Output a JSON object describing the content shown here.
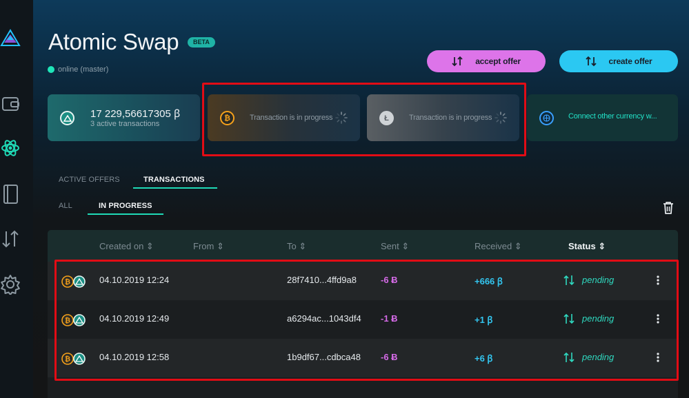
{
  "app": {
    "title": "Atomic Swap",
    "beta_badge": "BETA",
    "status": "online (master)"
  },
  "actions": {
    "accept_offer": "accept offer",
    "create_offer": "create offer"
  },
  "cards": {
    "main_balance": "17 229,56617305 ꞵ",
    "main_sub": "3 active transactions",
    "btc_status": "Transaction is in progress",
    "ltc_status": "Transaction is in progress",
    "connect_text": "Connect other currency w..."
  },
  "tabs": {
    "active_offers": "ACTIVE OFFERS",
    "transactions": "TRANSACTIONS",
    "all": "ALL",
    "in_progress": "IN PROGRESS"
  },
  "table": {
    "headers": {
      "created_on": "Created on ⇕",
      "from": "From ⇕",
      "to": "To ⇕",
      "sent": "Sent ⇕",
      "received": "Received ⇕",
      "status": "Status ⇕"
    },
    "rows": [
      {
        "created": "04.10.2019 12:24",
        "from": "",
        "to": "28f7410...4ffd9a8",
        "sent": "-6 Ƀ",
        "received": "+666 ꞵ",
        "status": "pending"
      },
      {
        "created": "04.10.2019 12:49",
        "from": "",
        "to": "a6294ac...1043df4",
        "sent": "-1 Ƀ",
        "received": "+1 ꞵ",
        "status": "pending"
      },
      {
        "created": "04.10.2019 12:58",
        "from": "",
        "to": "1b9df67...cdbca48",
        "sent": "-6 Ƀ",
        "received": "+6 ꞵ",
        "status": "pending"
      }
    ]
  },
  "icons": {
    "logo": "beam-logo-icon",
    "wallet": "wallet-icon",
    "atomic": "atom-icon",
    "addresses": "address-book-icon",
    "utxo": "utxo-arrows-icon",
    "settings": "gear-icon",
    "trash": "trash-icon"
  },
  "colors": {
    "accent_green": "#1fdbb7",
    "accept_button": "#dd74e9",
    "create_button": "#2bc8f2",
    "sent": "#d46ae6",
    "received": "#33c6f0",
    "pending": "#2fd9c0",
    "highlight": "#e20c15"
  }
}
